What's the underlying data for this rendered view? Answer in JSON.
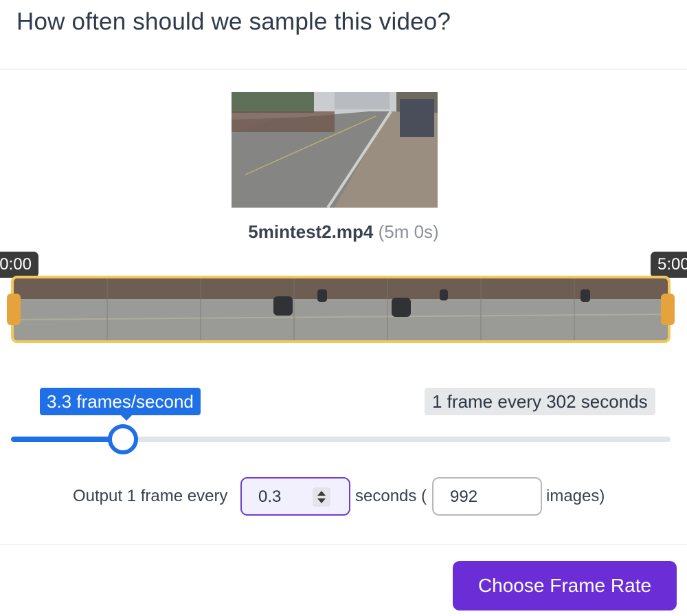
{
  "dialog": {
    "title": "How often should we sample this video?"
  },
  "video": {
    "file_name": "5mintest2.mp4",
    "duration": "(5m 0s)"
  },
  "timeline": {
    "start_label": "0:00",
    "end_label": "5:00",
    "highlight_color": "#f3c85a",
    "handle_color": "#e6a23c"
  },
  "slider": {
    "fps_label": "3.3 frames/second",
    "interval_label": "1 frame every 302 seconds",
    "value": 0.17,
    "accent_color": "#1f6fe6"
  },
  "output": {
    "prefix": "Output 1 frame every",
    "seconds_value": "0.3",
    "seconds_label": "seconds (",
    "images_value": "992",
    "images_suffix": "images)"
  },
  "actions": {
    "choose_label": "Choose Frame Rate",
    "button_color": "#6b2ed6"
  }
}
